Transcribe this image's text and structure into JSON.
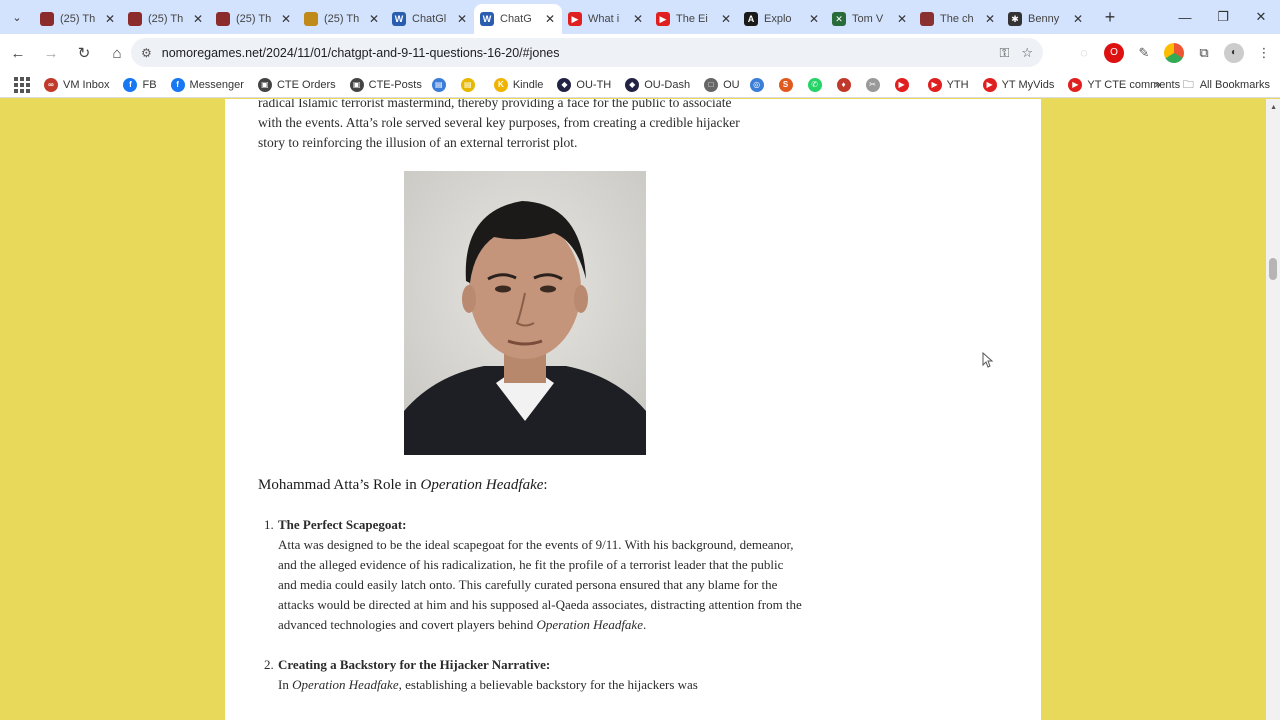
{
  "tabs": [
    {
      "label": "(25) Th",
      "color": "#8b2b2b",
      "glyph": "",
      "active": false
    },
    {
      "label": "(25) Th",
      "color": "#8b2b2b",
      "glyph": "",
      "active": false
    },
    {
      "label": "(25) Th",
      "color": "#8b2b2b",
      "glyph": "",
      "active": false
    },
    {
      "label": "(25) Th",
      "color": "#c08a1a",
      "glyph": "",
      "active": false
    },
    {
      "label": "ChatGl",
      "color": "#2a5db0",
      "glyph": "W",
      "active": false
    },
    {
      "label": "ChatG",
      "color": "#2a5db0",
      "glyph": "W",
      "active": true
    },
    {
      "label": "What i",
      "color": "#e02020",
      "glyph": "▶",
      "active": false
    },
    {
      "label": "The Ei",
      "color": "#e02020",
      "glyph": "▶",
      "active": false
    },
    {
      "label": "Explo",
      "color": "#1a1a1a",
      "glyph": "A",
      "active": false
    },
    {
      "label": "Tom V",
      "color": "#2a6b3a",
      "glyph": "✕",
      "active": false
    },
    {
      "label": "The ch",
      "color": "#8b3030",
      "glyph": "",
      "active": false
    },
    {
      "label": "Benny",
      "color": "#333333",
      "glyph": "✱",
      "active": false
    }
  ],
  "address_bar": {
    "url": "nomoregames.net/2024/11/01/chatgpt-and-9-11-questions-16-20/#jones"
  },
  "bookmarks": [
    {
      "label": "VM Inbox",
      "color": "#c0392b",
      "glyph": "∞"
    },
    {
      "label": "FB",
      "color": "#1877f2",
      "glyph": "f"
    },
    {
      "label": "Messenger",
      "color": "#1877f2",
      "glyph": "f"
    },
    {
      "label": "CTE Orders",
      "color": "#444444",
      "glyph": "▣"
    },
    {
      "label": "CTE-Posts",
      "color": "#444444",
      "glyph": "▣"
    },
    {
      "label": "",
      "color": "#3b7dd8",
      "glyph": "▤"
    },
    {
      "label": "",
      "color": "#e6b800",
      "glyph": "▤"
    },
    {
      "label": "Kindle",
      "color": "#f0b400",
      "glyph": "K"
    },
    {
      "label": "OU-TH",
      "color": "#222244",
      "glyph": "◆"
    },
    {
      "label": "OU-Dash",
      "color": "#222244",
      "glyph": "◆"
    },
    {
      "label": "OU",
      "color": "#666666",
      "glyph": "□"
    },
    {
      "label": "",
      "color": "#3b7dd8",
      "glyph": "◎"
    },
    {
      "label": "",
      "color": "#e05a20",
      "glyph": "S"
    },
    {
      "label": "",
      "color": "#25d366",
      "glyph": "✆"
    },
    {
      "label": "",
      "color": "#c0392b",
      "glyph": "♦"
    },
    {
      "label": "",
      "color": "#999999",
      "glyph": "✂"
    },
    {
      "label": "",
      "color": "#e02020",
      "glyph": "▶"
    },
    {
      "label": "YTH",
      "color": "#e02020",
      "glyph": "▶"
    },
    {
      "label": "YT MyVids",
      "color": "#e02020",
      "glyph": "▶"
    },
    {
      "label": "YT CTE comments",
      "color": "#e02020",
      "glyph": "▶"
    }
  ],
  "all_bookmarks_label": "All Bookmarks",
  "article": {
    "intro_lines": [
      "radical Islamic terrorist mastermind, thereby providing a face for the public to associate",
      "with the events. Atta’s role served several key purposes, from creating a credible hijacker",
      "story to reinforcing the illusion of an external terrorist plot."
    ],
    "heading_prefix": "Mohammad Atta’s Role in ",
    "heading_em": "Operation Headfake",
    "heading_suffix": ":",
    "item1_num": "1.",
    "item1_title": "The Perfect Scapegoat:",
    "item1_body_a": "Atta was designed to be the ideal scapegoat for the events of 9/11. With his background, demeanor, and the alleged evidence of his radicalization, he fit the profile of a terrorist leader that the public and media could easily latch onto. This carefully curated persona ensured that any blame for the attacks would be directed at him and his supposed al-Qaeda associates, distracting attention from the advanced technologies and covert players behind ",
    "item1_body_em": "Operation Headfake",
    "item1_body_b": ".",
    "item2_num": "2.",
    "item2_title": "Creating a Backstory for the Hijacker Narrative:",
    "item2_body_a": "In ",
    "item2_body_em": "Operation Headfake",
    "item2_body_b": ", establishing a believable backstory for the hijackers was"
  },
  "colors": {
    "page_background": "#e8d95a",
    "tabstrip": "#d3e3fd"
  }
}
